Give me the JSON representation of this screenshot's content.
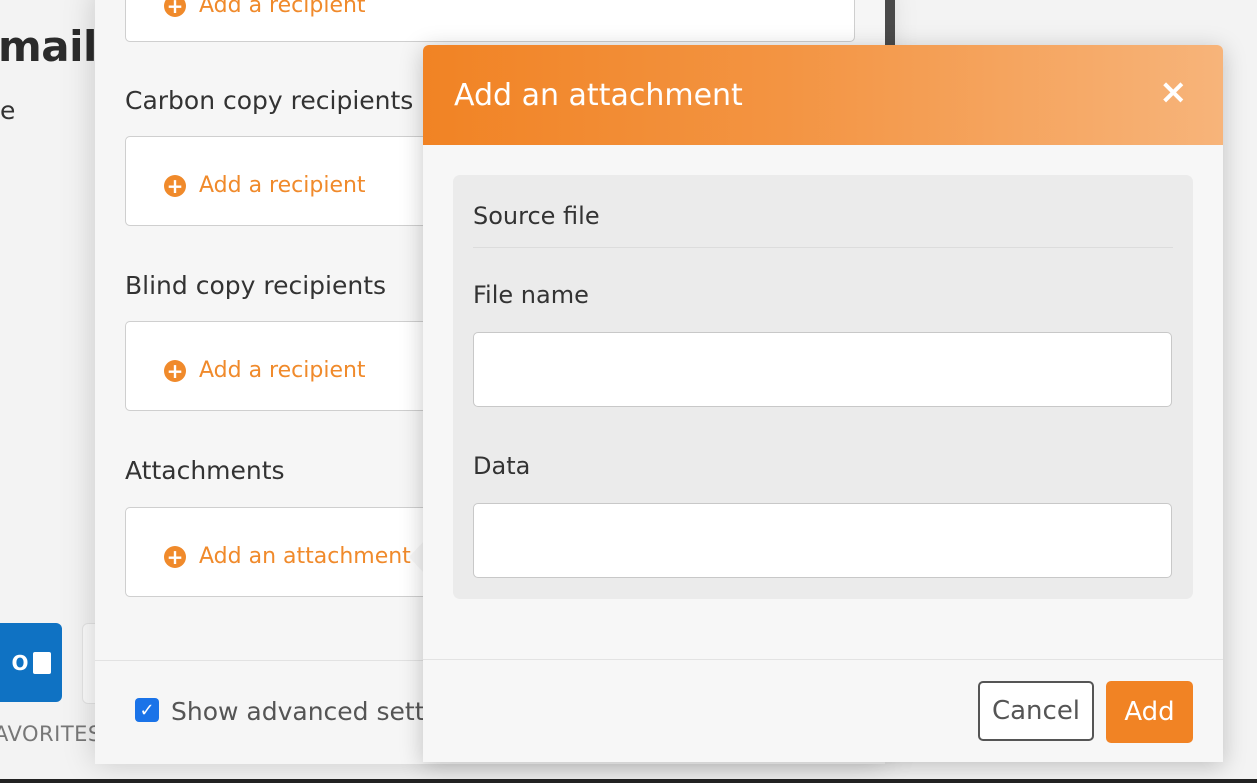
{
  "background": {
    "title_fragment": "mail",
    "subtitle_fragment": "e",
    "favorites_label": "AVORITES",
    "outlook_icon_letter": "O"
  },
  "panel": {
    "top_add_recipient": "Add a recipient",
    "cc_label": "Carbon copy recipients",
    "cc_add": "Add a recipient",
    "bcc_label": "Blind copy recipients",
    "bcc_add": "Add a recipient",
    "attachments_label": "Attachments",
    "attachments_add": "Add an attachment",
    "advanced_checked": true,
    "advanced_label": "Show advanced setti"
  },
  "modal": {
    "title": "Add an attachment",
    "close_symbol": "×",
    "card_heading": "Source file",
    "file_name_label": "File name",
    "file_name_value": "",
    "data_label": "Data",
    "data_value": "",
    "cancel_label": "Cancel",
    "add_label": "Add"
  },
  "colors": {
    "accent": "#f18324",
    "link": "#f08a2b",
    "checkbox": "#1a73e8",
    "outlook_blue": "#0f72c3"
  }
}
